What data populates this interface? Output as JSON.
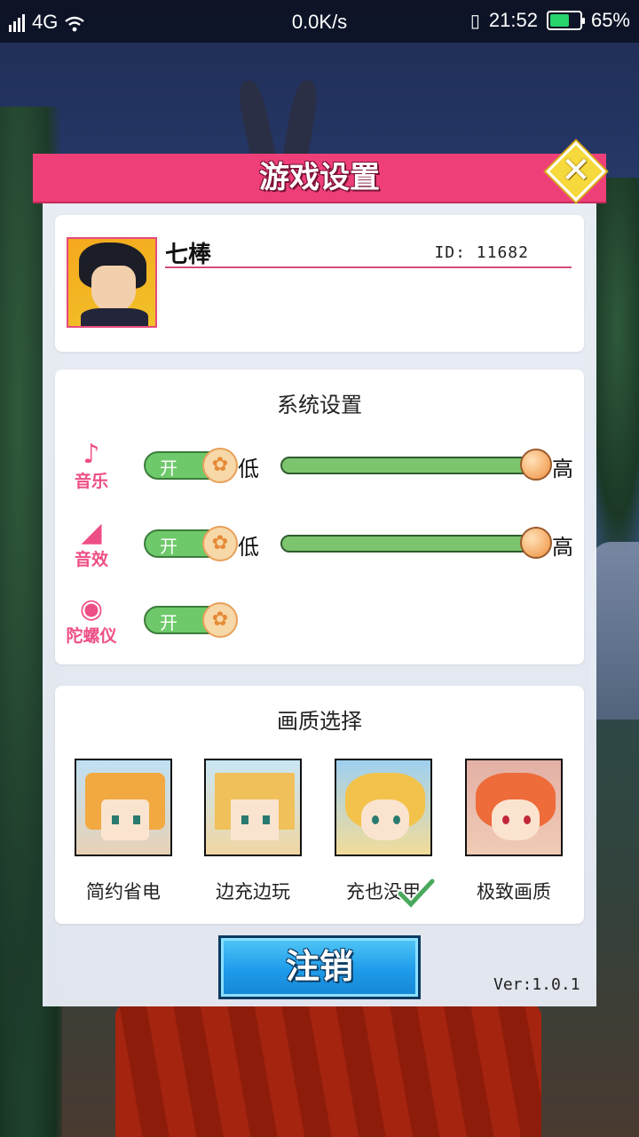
{
  "status_bar": {
    "network": "4G",
    "speed": "0.0K/s",
    "time": "21:52",
    "battery": "65%",
    "battery_level": 0.65
  },
  "dialog": {
    "title": "游戏设置",
    "close_icon": "close-x-icon"
  },
  "profile": {
    "name": "七棒",
    "id_text": "ID: 11682"
  },
  "system": {
    "title": "系统设置",
    "items": [
      {
        "label": "音乐",
        "icon": "music-note-icon",
        "toggle": "开",
        "low": "低",
        "high": "高",
        "level": 1.0
      },
      {
        "label": "音效",
        "icon": "speaker-icon",
        "toggle": "开",
        "low": "低",
        "high": "高",
        "level": 1.0
      },
      {
        "label": "陀螺仪",
        "icon": "gyroscope-icon",
        "toggle": "开"
      }
    ]
  },
  "quality": {
    "title": "画质选择",
    "options": [
      {
        "label": "简约省电",
        "selected": false
      },
      {
        "label": "边充边玩",
        "selected": false
      },
      {
        "label": "充也没用",
        "selected": true
      },
      {
        "label": "极致画质",
        "selected": false
      }
    ]
  },
  "footer": {
    "logout": "注销",
    "version": "Ver:1.0.1"
  },
  "colors": {
    "title_bar": "#ef3f78",
    "toggle_on": "#6ec96a",
    "accent_pink": "#ee4e86",
    "logout_blue": "#1e9bea"
  }
}
